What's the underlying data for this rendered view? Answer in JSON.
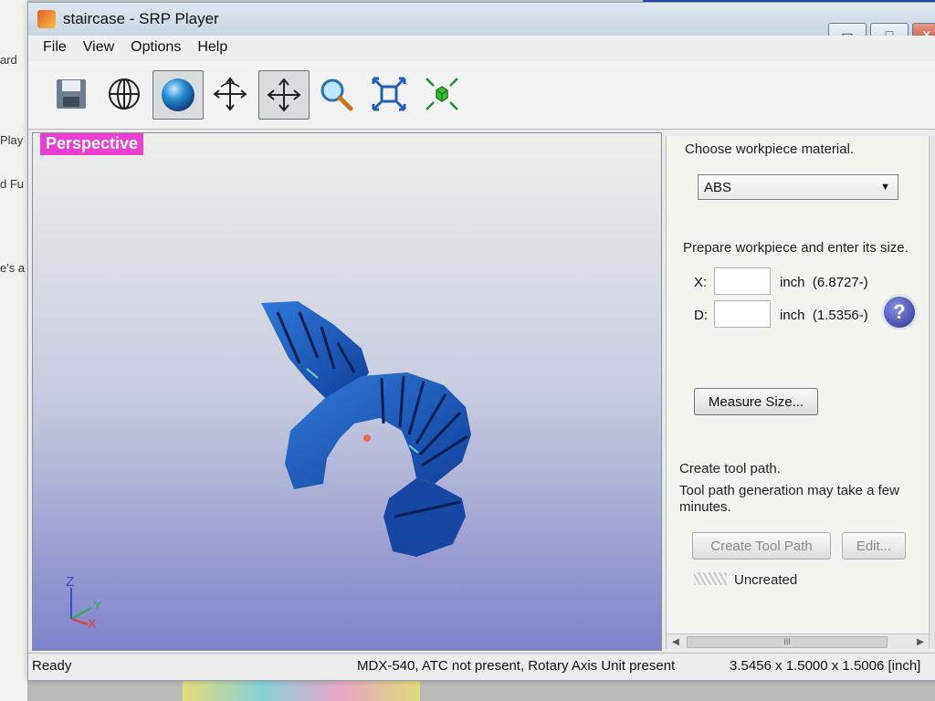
{
  "background": {
    "left_snippets": [
      "ard",
      "Play",
      "d Fu",
      "e's a"
    ]
  },
  "window": {
    "title": "staircase - SRP Player",
    "controls": {
      "minimize": "▭",
      "maximize": "□",
      "close": "✕"
    }
  },
  "menu": [
    "File",
    "View",
    "Options",
    "Help"
  ],
  "toolbar": {
    "buttons": [
      {
        "id": "save",
        "icon": "save-icon"
      },
      {
        "id": "globe",
        "icon": "globe-icon"
      },
      {
        "id": "sphere",
        "icon": "sphere-icon",
        "active": true
      },
      {
        "id": "rotate",
        "icon": "rotate-icon"
      },
      {
        "id": "pan",
        "icon": "move-icon",
        "active": true
      },
      {
        "id": "zoom",
        "icon": "zoom-icon"
      },
      {
        "id": "fit",
        "icon": "fit-icon"
      },
      {
        "id": "fit-green",
        "icon": "fit-cube-icon"
      }
    ]
  },
  "viewport": {
    "label": "Perspective",
    "axes": {
      "z": "Z",
      "y": "Y",
      "x": "X"
    }
  },
  "panel": {
    "material_prompt": "Choose workpiece material.",
    "material_value": "ABS",
    "size_prompt": "Prepare workpiece and enter its size.",
    "x_label": "X:",
    "x_unit": "inch",
    "x_hint": "(6.8727-)",
    "d_label": "D:",
    "d_unit": "inch",
    "d_hint": "(1.5356-)",
    "help_glyph": "?",
    "measure_button": "Measure Size...",
    "toolpath_title": "Create tool path.",
    "toolpath_note": "Tool path generation may take a few minutes.",
    "create_button": "Create Tool Path",
    "edit_button": "Edit...",
    "toolpath_status": "Uncreated",
    "scroll_thumb": "III"
  },
  "statusbar": {
    "left": "Ready",
    "center": "MDX-540, ATC not present, Rotary Axis Unit present",
    "right": "3.5456 x 1.5000 x 1.5006 [inch]"
  }
}
